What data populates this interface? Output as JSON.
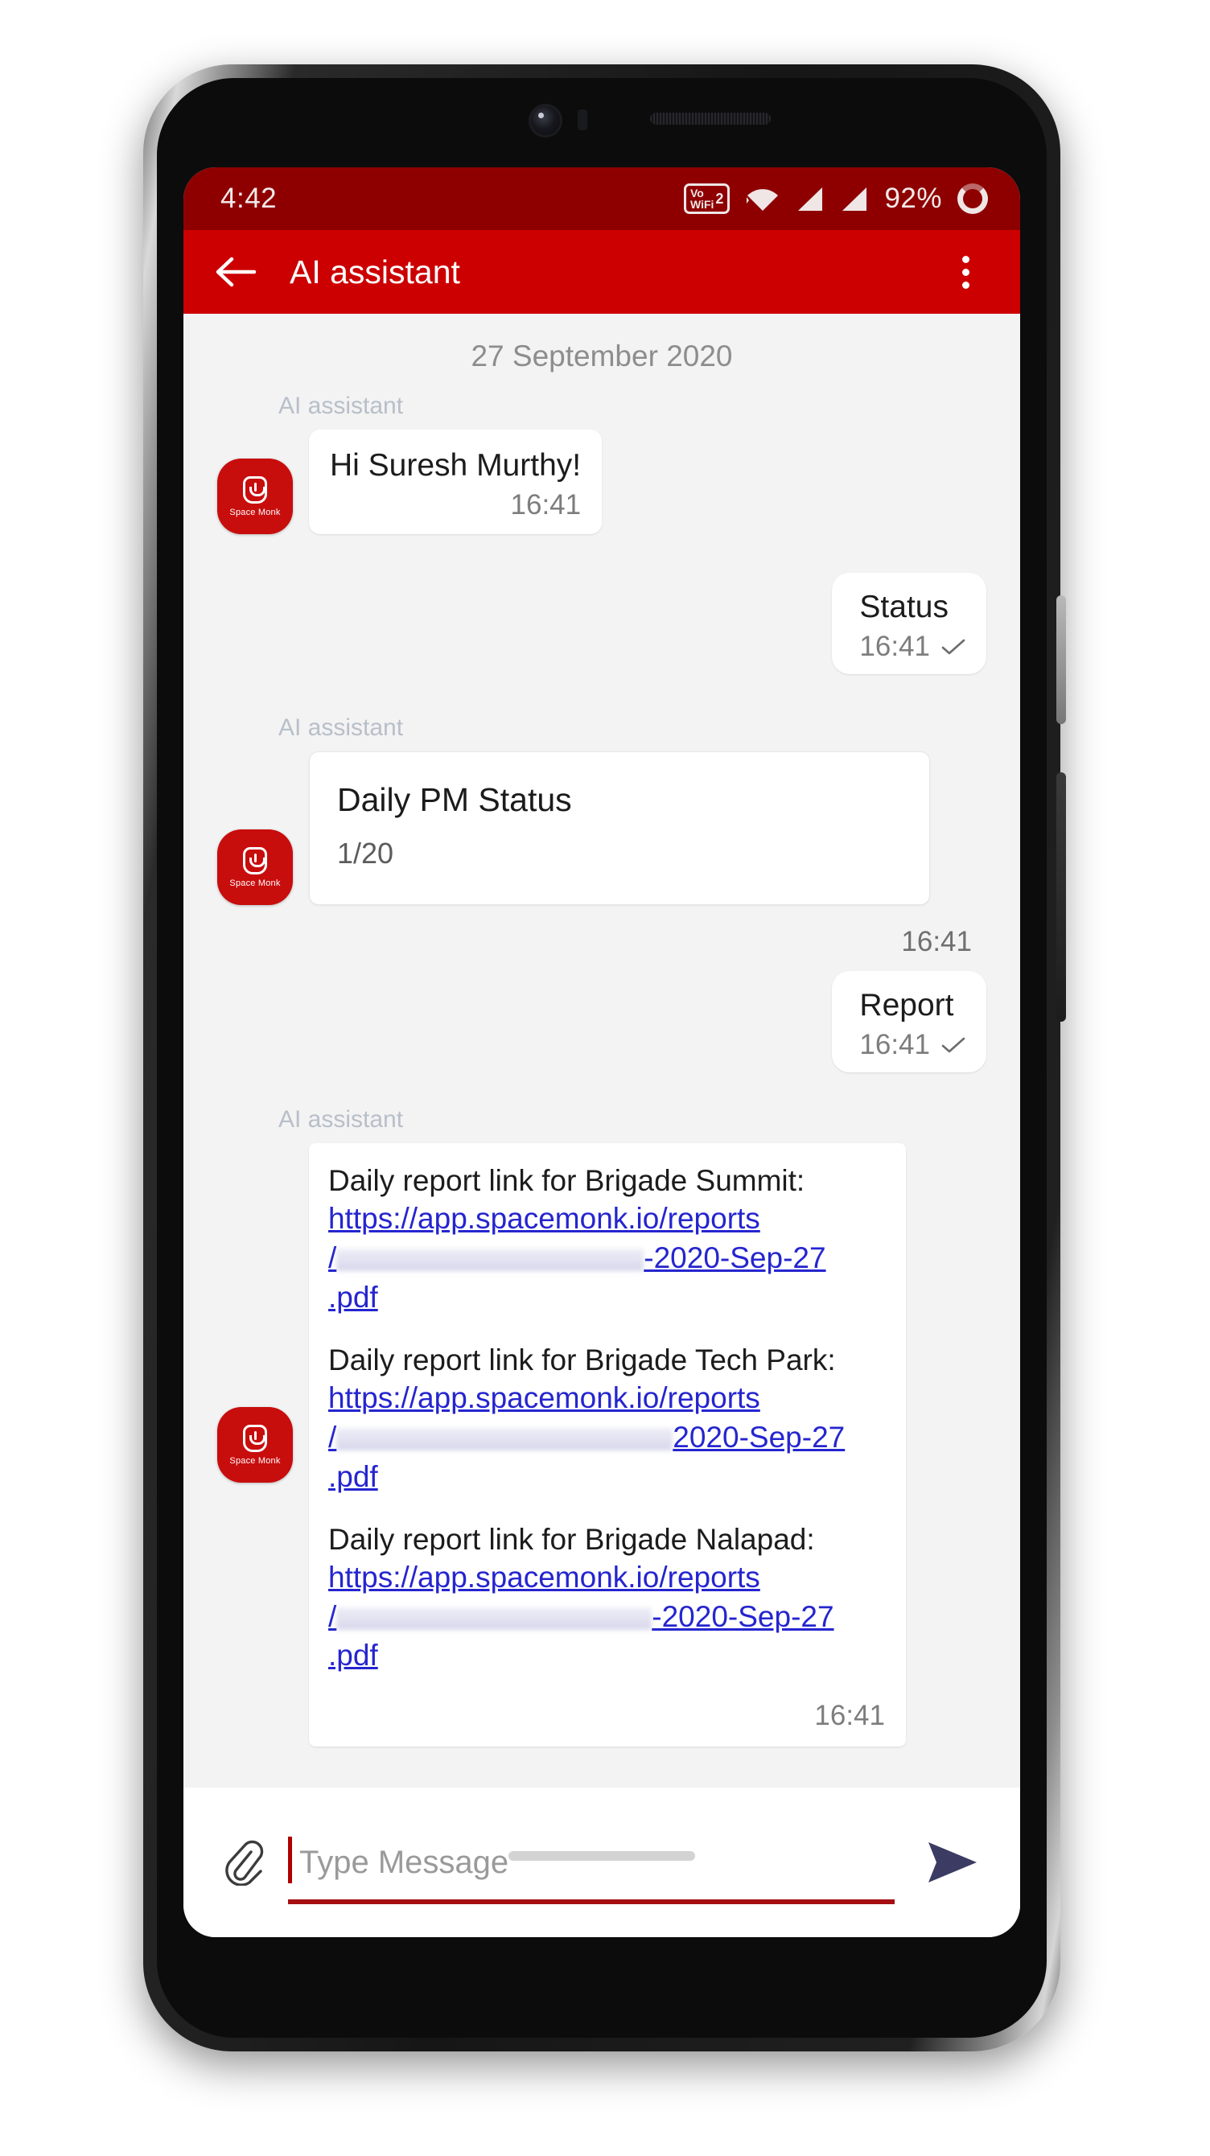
{
  "status_bar": {
    "time": "4:42",
    "battery_percent": "92%",
    "vowifi_label_top": "Vo",
    "vowifi_label_bottom": "WiFi",
    "vowifi_number": "2",
    "icons": [
      "vowifi-icon",
      "wifi-icon",
      "signal-icon-1",
      "signal-icon-2",
      "battery-ring-icon"
    ]
  },
  "app_bar": {
    "title": "AI assistant",
    "back_icon": "arrow-left-icon",
    "menu_icon": "overflow-menu-icon",
    "background_color": "#cc0000"
  },
  "chat": {
    "date_separator": "27 September 2020",
    "sender_name": "AI assistant",
    "avatar_label": "Space Monk",
    "messages": [
      {
        "kind": "incoming-text",
        "sender": "AI assistant",
        "text": "Hi Suresh Murthy!",
        "time": "16:41"
      },
      {
        "kind": "outgoing-text",
        "text": "Status",
        "time": "16:41",
        "status": "delivered"
      },
      {
        "kind": "incoming-card",
        "sender": "AI assistant",
        "card_title": "Daily PM Status",
        "card_subtitle": "1/20",
        "time": "16:41"
      },
      {
        "kind": "outgoing-text",
        "text": "Report",
        "time": "16:41",
        "status": "delivered"
      },
      {
        "kind": "incoming-links",
        "sender": "AI assistant",
        "time": "16:41",
        "groups": [
          {
            "lead": "Daily report link for Brigade Summit:",
            "url_head": "https://app.spacemonk.io/reports",
            "url_slash": "/",
            "url_tail": "-2020-Sep-27",
            "url_ext": ".pdf"
          },
          {
            "lead": "Daily report link for Brigade Tech Park:",
            "url_head": "https://app.spacemonk.io/reports",
            "url_slash": "/",
            "url_tail": "2020-Sep-27",
            "url_ext": ".pdf"
          },
          {
            "lead": "Daily report link for Brigade Nalapad:",
            "url_head": "https://app.spacemonk.io/reports",
            "url_slash": "/",
            "url_tail": "-2020-Sep-27",
            "url_ext": ".pdf"
          }
        ]
      }
    ]
  },
  "composer": {
    "attach_icon": "paperclip-icon",
    "input_value": "",
    "placeholder": "Type Message",
    "send_icon": "send-arrow-icon",
    "accent_color": "#a60f12"
  }
}
